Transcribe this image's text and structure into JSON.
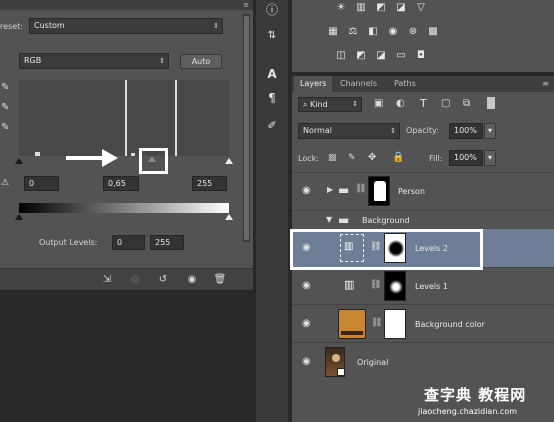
{
  "properties": {
    "preset_label": "reset:",
    "preset_value": "Custom",
    "channel_value": "RGB",
    "auto_label": "Auto",
    "input_black": "0",
    "input_gamma": "0,65",
    "input_white": "255",
    "output_label": "Output Levels:",
    "output_black": "0",
    "output_white": "255"
  },
  "tools": {
    "info_icon": "info-icon",
    "char_icon": "character-icon",
    "paragraph_icon": "paragraph-icon",
    "brush_icon": "brush-presets-icon"
  },
  "layers_panel": {
    "tabs": [
      "Layers",
      "Channels",
      "Paths"
    ],
    "kind_label": "Kind",
    "blend_mode": "Normal",
    "opacity_label": "Opacity:",
    "opacity_value": "100%",
    "lock_label": "Lock:",
    "fill_label": "Fill:",
    "fill_value": "100%",
    "layers": [
      {
        "name": "Person"
      },
      {
        "name": "Background"
      },
      {
        "name": "Levels 2"
      },
      {
        "name": "Levels 1"
      },
      {
        "name": "Background color"
      },
      {
        "name": "Original"
      }
    ]
  },
  "watermark": {
    "main": "查字典 教程网",
    "sub": "jiaocheng.chazidian.com"
  },
  "colors": {
    "panel": "#535353",
    "selected_layer": "#6d7e96",
    "annotation": "#ffffff"
  }
}
